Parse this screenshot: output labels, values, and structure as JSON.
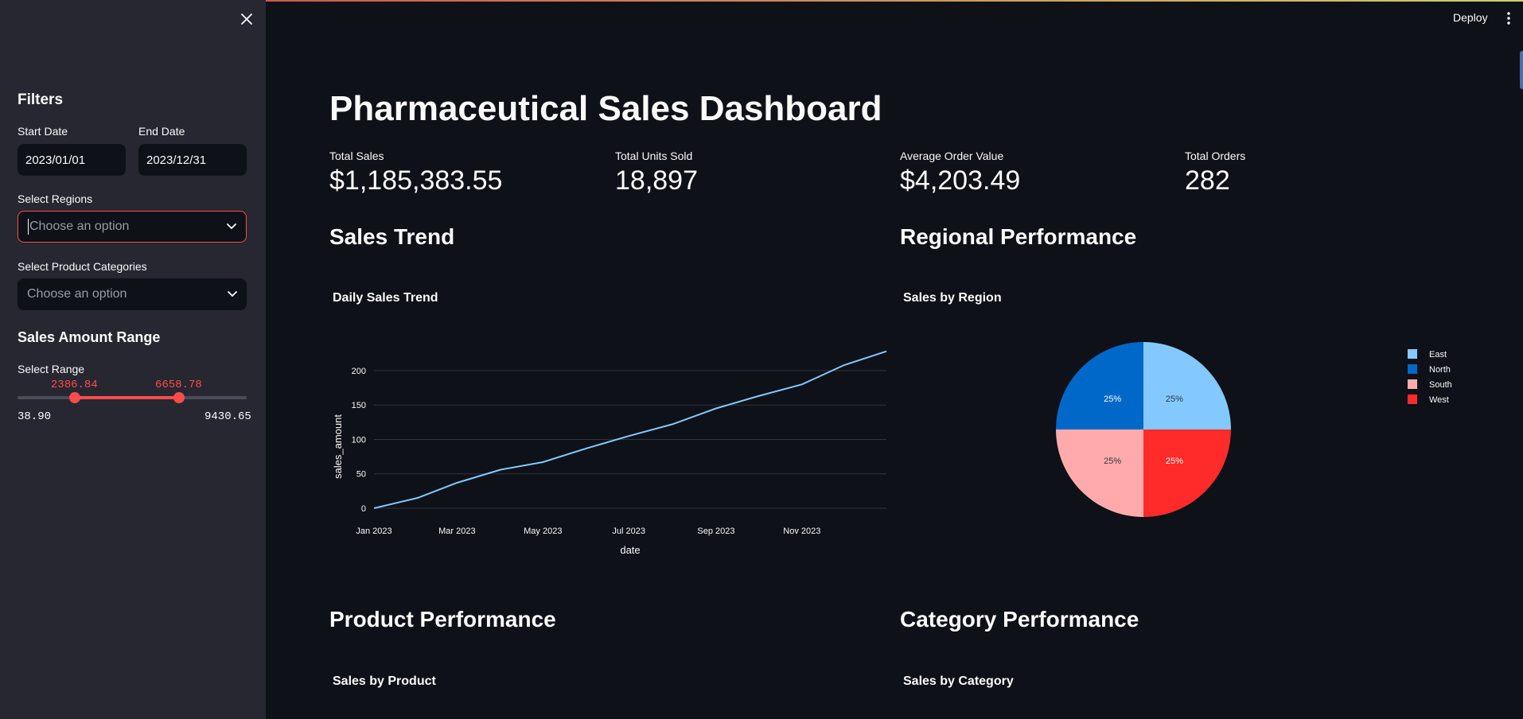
{
  "sidebar": {
    "filters_heading": "Filters",
    "start_date_label": "Start Date",
    "start_date_value": "2023/01/01",
    "end_date_label": "End Date",
    "end_date_value": "2023/12/31",
    "regions_label": "Select Regions",
    "regions_placeholder": "Choose an option",
    "categories_label": "Select Product Categories",
    "categories_placeholder": "Choose an option",
    "range_heading": "Sales Amount Range",
    "range_label": "Select Range",
    "range_low": "2386.84",
    "range_high": "6658.78",
    "range_min": "38.90",
    "range_max": "9430.65",
    "range_low_fraction": 0.2497,
    "range_high_fraction": 0.7048
  },
  "toolbar": {
    "deploy_label": "Deploy"
  },
  "main": {
    "title": "Pharmaceutical Sales Dashboard",
    "metrics": [
      {
        "label": "Total Sales",
        "value": "$1,185,383.55"
      },
      {
        "label": "Total Units Sold",
        "value": "18,897"
      },
      {
        "label": "Average Order Value",
        "value": "$4,203.49"
      },
      {
        "label": "Total Orders",
        "value": "282"
      }
    ],
    "sections": {
      "sales_trend": "Sales Trend",
      "regional_performance": "Regional Performance",
      "product_performance": "Product Performance",
      "category_performance": "Category Performance"
    },
    "chart_titles": {
      "sales_by_product": "Sales by Product",
      "sales_by_category": "Sales by Category"
    }
  },
  "chart_data": [
    {
      "type": "line",
      "title": "Daily Sales Trend",
      "xlabel": "date",
      "ylabel": "sales_amount",
      "x_ticks": [
        "Jan 2023",
        "Mar 2023",
        "May 2023",
        "Jul 2023",
        "Sep 2023",
        "Nov 2023"
      ],
      "y_ticks": [
        0,
        50,
        100,
        150,
        200
      ],
      "ylim": [
        0,
        230
      ],
      "grid": true,
      "color": "#83c9ff",
      "x": [
        "2023-01-01",
        "2023-02-01",
        "2023-03-01",
        "2023-04-01",
        "2023-05-01",
        "2023-06-01",
        "2023-07-01",
        "2023-08-01",
        "2023-09-01",
        "2023-10-01",
        "2023-11-01",
        "2023-12-01",
        "2023-12-31"
      ],
      "values": [
        0,
        15,
        37,
        56,
        67,
        87,
        105,
        122,
        145,
        163,
        180,
        208,
        228
      ]
    },
    {
      "type": "pie",
      "title": "Sales by Region",
      "legend_position": "right",
      "slices": [
        {
          "name": "East",
          "value": 25,
          "label": "25%",
          "color": "#83c9ff"
        },
        {
          "name": "West",
          "value": 25,
          "label": "25%",
          "color": "#ff2b2b"
        },
        {
          "name": "South",
          "value": 25,
          "label": "25%",
          "color": "#ffabab"
        },
        {
          "name": "North",
          "value": 25,
          "label": "25%",
          "color": "#0068c9"
        }
      ],
      "legend_order": [
        "East",
        "North",
        "South",
        "West"
      ]
    }
  ]
}
